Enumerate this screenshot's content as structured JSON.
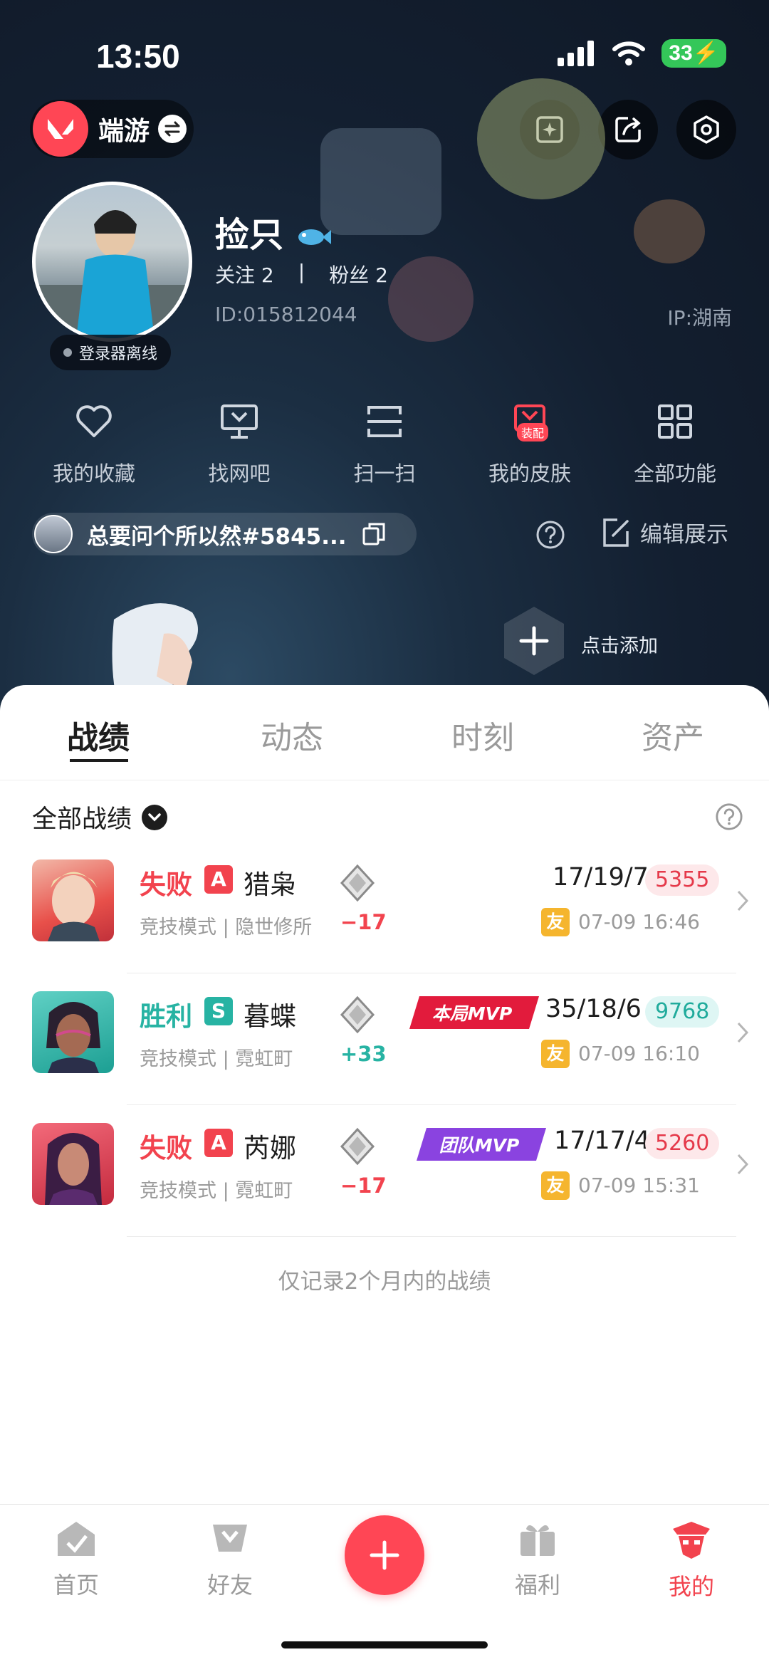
{
  "status_bar": {
    "time": "13:50",
    "battery": "33"
  },
  "header": {
    "app_name": "端游"
  },
  "profile": {
    "nickname": "捡只",
    "following_label": "关注",
    "following_count": "2",
    "separator": "|",
    "fans_label": "粉丝",
    "fans_count": "2",
    "id": "ID:015812044",
    "ip": "IP:湖南",
    "login_status": "登录器离线"
  },
  "quick_actions": [
    {
      "label": "我的收藏",
      "icon": "heart-icon"
    },
    {
      "label": "找网吧",
      "icon": "monitor-icon"
    },
    {
      "label": "扫一扫",
      "icon": "scan-icon"
    },
    {
      "label": "我的皮肤",
      "icon": "skin-icon",
      "badge": "装配"
    },
    {
      "label": "全部功能",
      "icon": "grid-icon"
    }
  ],
  "showcase": {
    "riot_id": "总要问个所以然#5845...",
    "edit_label": "编辑展示",
    "add_label": "点击添加"
  },
  "tabs": [
    "战绩",
    "动态",
    "时刻",
    "资产"
  ],
  "section": {
    "title": "全部战绩"
  },
  "matches": [
    {
      "result": "失败",
      "rank_tag": "A",
      "agent": "猎枭",
      "mode": "竞技模式 | 隐世修所",
      "rr": "−17",
      "mvp": "",
      "kda": "17/19/7",
      "acs": "5355",
      "friend_tag": "友",
      "time": "07-09 16:46"
    },
    {
      "result": "胜利",
      "rank_tag": "S",
      "agent": "暮蝶",
      "mode": "竞技模式 | 霓虹町",
      "rr": "+33",
      "mvp": "本局MVP",
      "kda": "35/18/6",
      "acs": "9768",
      "friend_tag": "友",
      "time": "07-09 16:10"
    },
    {
      "result": "失败",
      "rank_tag": "A",
      "agent": "芮娜",
      "mode": "竞技模式 | 霓虹町",
      "rr": "−17",
      "mvp": "团队MVP",
      "kda": "17/17/4",
      "acs": "5260",
      "friend_tag": "友",
      "time": "07-09 15:31"
    }
  ],
  "footnote": "仅记录2个月内的战绩",
  "bottom_nav": [
    {
      "label": "首页",
      "icon": "home-icon"
    },
    {
      "label": "好友",
      "icon": "friends-icon"
    },
    {
      "label": "福利",
      "icon": "gift-icon"
    },
    {
      "label": "我的",
      "icon": "profile-icon"
    }
  ],
  "colors": {
    "accent": "#ff4655",
    "lose": "#f2434e",
    "win": "#27b3a3",
    "friend": "#f5b52e"
  }
}
